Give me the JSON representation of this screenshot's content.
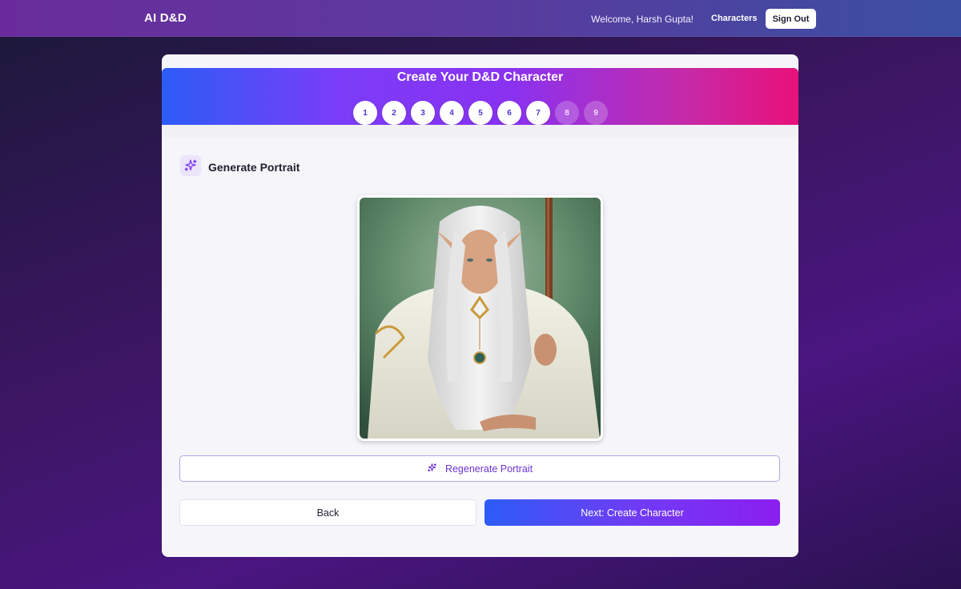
{
  "nav": {
    "brand": "AI D&D",
    "welcome": "Welcome, Harsh Gupta!",
    "characters_link": "Characters",
    "sign_out": "Sign Out"
  },
  "wizard": {
    "title": "Create Your D&D Character",
    "steps": [
      {
        "label": "1",
        "state": "done"
      },
      {
        "label": "2",
        "state": "done"
      },
      {
        "label": "3",
        "state": "done"
      },
      {
        "label": "4",
        "state": "done"
      },
      {
        "label": "5",
        "state": "done"
      },
      {
        "label": "6",
        "state": "done"
      },
      {
        "label": "7",
        "state": "current"
      },
      {
        "label": "8",
        "state": "future"
      },
      {
        "label": "9",
        "state": "future"
      }
    ],
    "current_step": 7
  },
  "section": {
    "title": "Generate Portrait",
    "icon": "sparkles-icon"
  },
  "portrait": {
    "alt": "Generated character portrait"
  },
  "actions": {
    "regenerate": "Regenerate Portrait",
    "back": "Back",
    "next": "Next: Create Character"
  },
  "colors": {
    "accent": "#7b3cf8",
    "accent_text": "#6c35d0",
    "gradient_start": "#2d5cf6",
    "gradient_end": "#e8117a"
  }
}
